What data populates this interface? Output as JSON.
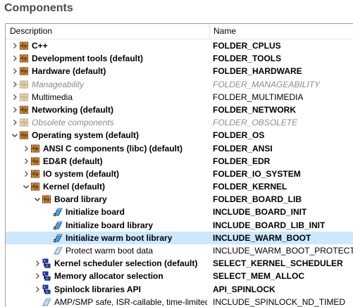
{
  "title": "Components",
  "columns": {
    "description": "Description",
    "name": "Name"
  },
  "rows": [
    {
      "label": "C++",
      "name": "FOLDER_CPLUS",
      "level": 0,
      "expander": "collapsed",
      "icon": "folder-grid-icon",
      "style": "bold",
      "selected": false
    },
    {
      "label": "Development tools (default)",
      "name": "FOLDER_TOOLS",
      "level": 0,
      "expander": "collapsed",
      "icon": "folder-grid-icon",
      "style": "bold",
      "selected": false
    },
    {
      "label": "Hardware (default)",
      "name": "FOLDER_HARDWARE",
      "level": 0,
      "expander": "collapsed",
      "icon": "folder-grid-icon",
      "style": "bold",
      "selected": false
    },
    {
      "label": "Manageability",
      "name": "FOLDER_MANAGEABILITY",
      "level": 0,
      "expander": "collapsed",
      "icon": "folder-grid-disabled-icon",
      "style": "disabled",
      "selected": false
    },
    {
      "label": "Multimedia",
      "name": "FOLDER_MULTIMEDIA",
      "level": 0,
      "expander": "collapsed",
      "icon": "folder-grid-disabled-icon",
      "style": "normal",
      "selected": false
    },
    {
      "label": "Networking (default)",
      "name": "FOLDER_NETWORK",
      "level": 0,
      "expander": "collapsed",
      "icon": "folder-grid-icon",
      "style": "bold",
      "selected": false
    },
    {
      "label": "Obsolete components",
      "name": "FOLDER_OBSOLETE",
      "level": 0,
      "expander": "collapsed",
      "icon": "folder-grid-disabled-icon",
      "style": "disabled",
      "selected": false
    },
    {
      "label": "Operating system (default)",
      "name": "FOLDER_OS",
      "level": 0,
      "expander": "expanded",
      "icon": "folder-grid-icon",
      "style": "bold",
      "selected": false
    },
    {
      "label": "ANSI C components (libc) (default)",
      "name": "FOLDER_ANSI",
      "level": 1,
      "expander": "collapsed",
      "icon": "folder-grid-icon",
      "style": "bold",
      "selected": false
    },
    {
      "label": "ED&R (default)",
      "name": "FOLDER_EDR",
      "level": 1,
      "expander": "collapsed",
      "icon": "folder-grid-icon",
      "style": "bold",
      "selected": false
    },
    {
      "label": "IO system (default)",
      "name": "FOLDER_IO_SYSTEM",
      "level": 1,
      "expander": "collapsed",
      "icon": "folder-grid-icon",
      "style": "bold",
      "selected": false
    },
    {
      "label": "Kernel (default)",
      "name": "FOLDER_KERNEL",
      "level": 1,
      "expander": "expanded",
      "icon": "folder-grid-icon",
      "style": "bold",
      "selected": false
    },
    {
      "label": "Board library",
      "name": "FOLDER_BOARD_LIB",
      "level": 2,
      "expander": "expanded",
      "icon": "folder-grid-icon",
      "style": "bold",
      "selected": false
    },
    {
      "label": "Initialize board",
      "name": "INCLUDE_BOARD_INIT",
      "level": 3,
      "expander": "none",
      "icon": "component-included-icon",
      "style": "bold",
      "selected": false
    },
    {
      "label": "Initialize board library",
      "name": "INCLUDE_BOARD_LIB_INIT",
      "level": 3,
      "expander": "none",
      "icon": "component-included-icon",
      "style": "bold",
      "selected": false
    },
    {
      "label": "Initialize warm boot library",
      "name": "INCLUDE_WARM_BOOT",
      "level": 3,
      "expander": "none",
      "icon": "component-included-icon",
      "style": "bold",
      "selected": true
    },
    {
      "label": "Protect warm boot data",
      "name": "INCLUDE_WARM_BOOT_PROTECT",
      "level": 3,
      "expander": "none",
      "icon": "component-available-icon",
      "style": "normal",
      "selected": false
    },
    {
      "label": "Kernel scheduler selection (default)",
      "name": "SELECT_KERNEL_SCHEDULER",
      "level": 2,
      "expander": "collapsed",
      "icon": "selection-icon",
      "style": "bold",
      "selected": false
    },
    {
      "label": "Memory allocator selection",
      "name": "SELECT_MEM_ALLOC",
      "level": 2,
      "expander": "collapsed",
      "icon": "selection-icon",
      "style": "bold",
      "selected": false
    },
    {
      "label": "Spinlock libraries API",
      "name": "API_SPINLOCK",
      "level": 2,
      "expander": "collapsed",
      "icon": "selection-icon",
      "style": "bold",
      "selected": false
    },
    {
      "label": "AMP/SMP safe, ISR-callable, time-limited",
      "name": "INCLUDE_SPINLOCK_ND_TIMED",
      "level": 2,
      "expander": "none",
      "icon": "component-available-icon",
      "style": "normal",
      "selected": false
    }
  ]
}
